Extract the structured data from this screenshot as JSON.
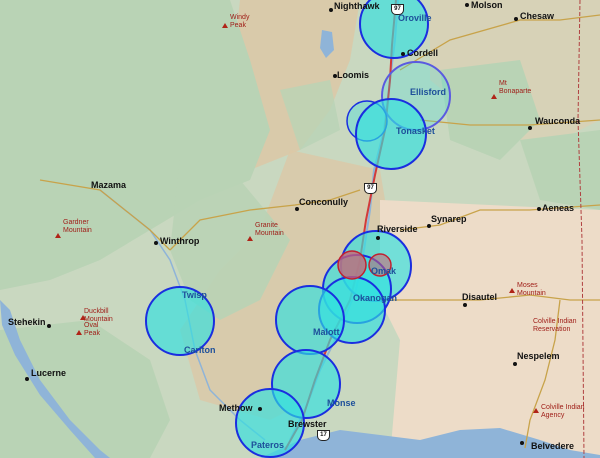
{
  "map": {
    "towns": [
      {
        "id": "nighthawk",
        "name": "Nighthawk",
        "color": "dark"
      },
      {
        "id": "oroville",
        "name": "Oroville",
        "color": "blue"
      },
      {
        "id": "molson",
        "name": "Molson",
        "color": "dark"
      },
      {
        "id": "chesaw",
        "name": "Chesaw",
        "color": "dark"
      },
      {
        "id": "cordell",
        "name": "Cordell",
        "color": "dark"
      },
      {
        "id": "loomis",
        "name": "Loomis",
        "color": "dark"
      },
      {
        "id": "ellisford",
        "name": "Ellisford",
        "color": "blue"
      },
      {
        "id": "tonasket",
        "name": "Tonasket",
        "color": "blue"
      },
      {
        "id": "wauconda",
        "name": "Wauconda",
        "color": "dark"
      },
      {
        "id": "mazama",
        "name": "Mazama",
        "color": "dark"
      },
      {
        "id": "conconully",
        "name": "Conconully",
        "color": "dark"
      },
      {
        "id": "aeneas",
        "name": "Aeneas",
        "color": "dark"
      },
      {
        "id": "riverside",
        "name": "Riverside",
        "color": "dark"
      },
      {
        "id": "synarep",
        "name": "Synarep",
        "color": "dark"
      },
      {
        "id": "winthrop",
        "name": "Winthrop",
        "color": "dark"
      },
      {
        "id": "omak",
        "name": "Omak",
        "color": "blue"
      },
      {
        "id": "okanogan",
        "name": "Okanogan",
        "color": "blue"
      },
      {
        "id": "disautel",
        "name": "Disautel",
        "color": "dark"
      },
      {
        "id": "twisp",
        "name": "Twisp",
        "color": "blue"
      },
      {
        "id": "stehekin",
        "name": "Stehekin",
        "color": "dark"
      },
      {
        "id": "malott",
        "name": "Malott",
        "color": "blue"
      },
      {
        "id": "carlton",
        "name": "Carlton",
        "color": "blue"
      },
      {
        "id": "lucerne",
        "name": "Lucerne",
        "color": "dark"
      },
      {
        "id": "nespelem",
        "name": "Nespelem",
        "color": "dark"
      },
      {
        "id": "methow",
        "name": "Methow",
        "color": "dark"
      },
      {
        "id": "monse",
        "name": "Monse",
        "color": "blue"
      },
      {
        "id": "brewster",
        "name": "Brewster",
        "color": "dark"
      },
      {
        "id": "pateros",
        "name": "Pateros",
        "color": "blue"
      },
      {
        "id": "belvedere",
        "name": "Belvedere",
        "color": "dark"
      }
    ],
    "peaks": [
      {
        "id": "windy",
        "lines": [
          "Windy",
          "Peak"
        ]
      },
      {
        "id": "bonaparte",
        "lines": [
          "Mt",
          "Bonaparte"
        ]
      },
      {
        "id": "gardner",
        "lines": [
          "Gardner",
          "Mountain"
        ]
      },
      {
        "id": "granite",
        "lines": [
          "Granite",
          "Mountain"
        ]
      },
      {
        "id": "moses",
        "lines": [
          "Moses",
          "Mountain"
        ]
      },
      {
        "id": "duckbill",
        "lines": [
          "Duckbill",
          "Mountain"
        ]
      },
      {
        "id": "oval",
        "lines": [
          "Oval",
          "Peak"
        ]
      },
      {
        "id": "colville",
        "lines": [
          "Colville Indian",
          "Reservation"
        ]
      },
      {
        "id": "colville_agency",
        "lines": [
          "Colville Indian",
          "Agency"
        ]
      }
    ],
    "shields": [
      {
        "id": "us97_north",
        "text": "97"
      },
      {
        "id": "us97_mid",
        "text": "97"
      },
      {
        "id": "us97_south",
        "text": "17"
      }
    ],
    "colors": {
      "forest": "#b9d3b5",
      "terrain": "#d8c6a6",
      "reservation": "#eddcc8",
      "river": "#8fb4d8",
      "highway": "#d23a3a",
      "coverage_fill": "#2fe0e0",
      "coverage_stroke": "#1a2ee0",
      "flagged_fill": "#d06070",
      "flagged_stroke": "#c02030"
    }
  }
}
